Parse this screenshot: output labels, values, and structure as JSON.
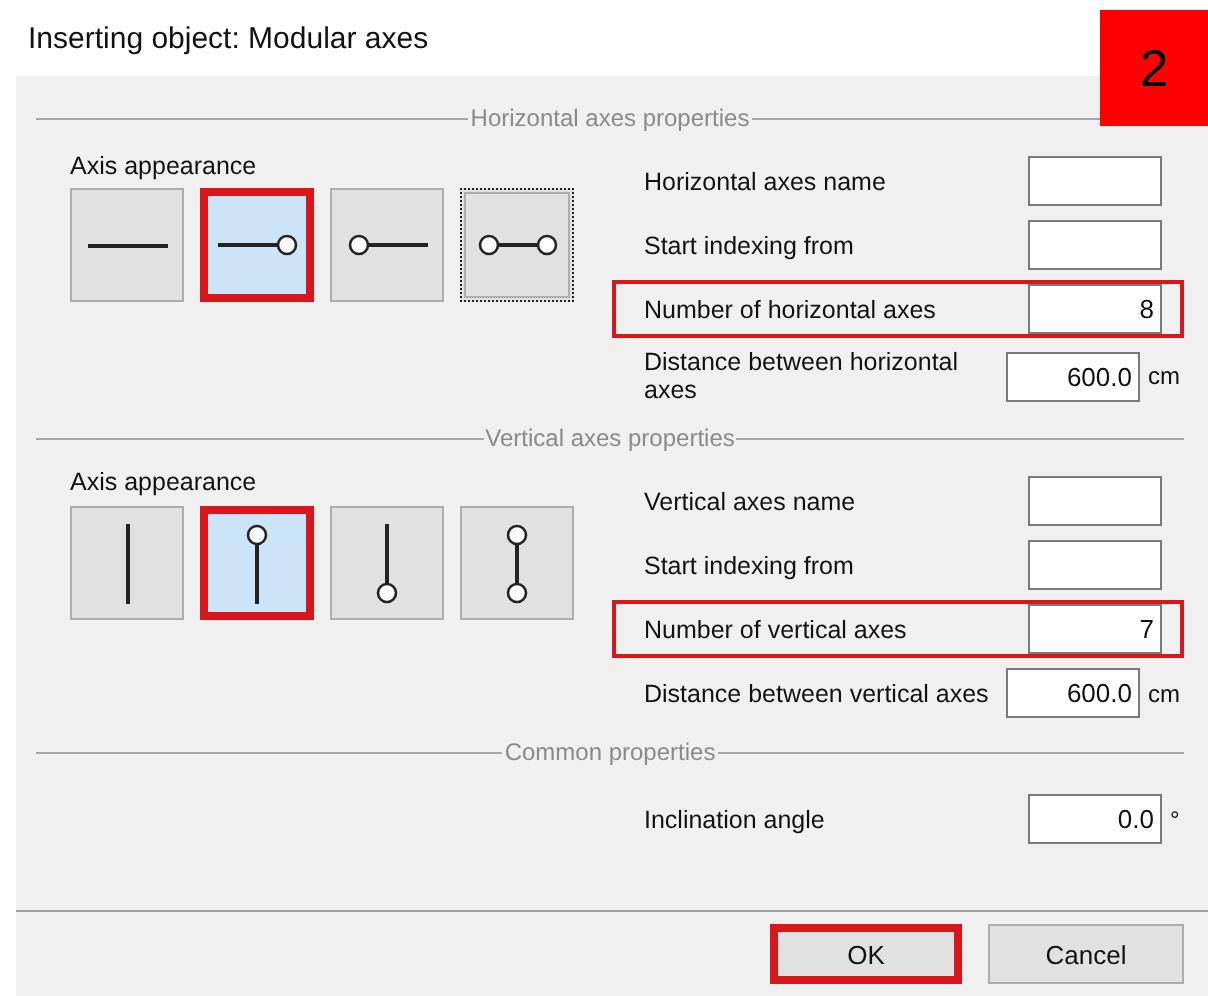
{
  "window": {
    "title": "Inserting object: Modular axes"
  },
  "step_badge": "2",
  "sections": [
    {
      "title": "Horizontal axes properties",
      "kind": "horizontal",
      "appearance_label": "Axis appearance",
      "options": [
        {
          "kind": "plain",
          "selected": false,
          "highlighted": false,
          "focused": false
        },
        {
          "kind": "end",
          "selected": true,
          "highlighted": true,
          "focused": false
        },
        {
          "kind": "start",
          "selected": false,
          "highlighted": false,
          "focused": false
        },
        {
          "kind": "both",
          "selected": false,
          "highlighted": false,
          "focused": true
        }
      ],
      "fields": [
        {
          "label": "Horizontal axes name",
          "highlighted": false
        },
        {
          "label": "Start indexing from",
          "highlighted": false
        },
        {
          "label": "Number of horizontal axes",
          "value": "8",
          "highlighted": true
        },
        {
          "label": "Distance between horizontal axes",
          "value": "600.0",
          "unit": "cm",
          "highlighted": false
        }
      ]
    },
    {
      "title": "Vertical axes properties",
      "kind": "vertical",
      "appearance_label": "Axis appearance",
      "options": [
        {
          "kind": "plain",
          "selected": false,
          "highlighted": false,
          "focused": false
        },
        {
          "kind": "end",
          "selected": true,
          "highlighted": true,
          "focused": false
        },
        {
          "kind": "start",
          "selected": false,
          "highlighted": false,
          "focused": false
        },
        {
          "kind": "both",
          "selected": false,
          "highlighted": false,
          "focused": false
        }
      ],
      "fields": [
        {
          "label": "Vertical axes name",
          "highlighted": false
        },
        {
          "label": "Start indexing from",
          "highlighted": false
        },
        {
          "label": "Number of vertical axes",
          "value": "7",
          "highlighted": true
        },
        {
          "label": "Distance between vertical axes",
          "value": "600.0",
          "unit": "cm",
          "highlighted": false
        }
      ]
    },
    {
      "title": "Common properties",
      "kind": "common",
      "fields": [
        {
          "label": "Inclination angle",
          "value": "0.0",
          "unit": "°",
          "highlighted": false
        }
      ]
    }
  ],
  "buttons": [
    {
      "label": "OK",
      "highlighted": true
    },
    {
      "label": "Cancel",
      "highlighted": false
    }
  ]
}
